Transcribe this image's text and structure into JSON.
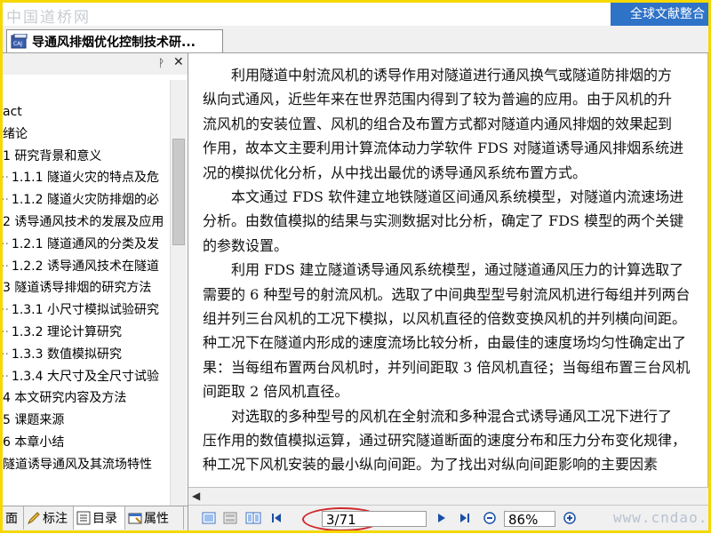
{
  "header": {
    "site_logo": "中国道桥网",
    "banner_text": "全球文献整合"
  },
  "tab": {
    "title": "导通风排烟优化控制技术研..."
  },
  "left_panel": {
    "toc": [
      {
        "label": "act",
        "level": 0
      },
      {
        "label": "绪论",
        "level": 0
      },
      {
        "label": "1 研究背景和意义",
        "level": 1
      },
      {
        "label": "1.1.1 隧道火灾的特点及危",
        "level": 3
      },
      {
        "label": "1.1.2 隧道火灾防排烟的必",
        "level": 3
      },
      {
        "label": "2 诱导通风技术的发展及应用",
        "level": 1
      },
      {
        "label": "1.2.1 隧道通风的分类及发",
        "level": 3
      },
      {
        "label": "1.2.2 诱导通风技术在隧道",
        "level": 3
      },
      {
        "label": "3 隧道诱导排烟的研究方法",
        "level": 1
      },
      {
        "label": "1.3.1 小尺寸模拟试验研究",
        "level": 3
      },
      {
        "label": "1.3.2 理论计算研究",
        "level": 3
      },
      {
        "label": "1.3.3 数值模拟研究",
        "level": 3
      },
      {
        "label": "1.3.4 大尺寸及全尺寸试验",
        "level": 3
      },
      {
        "label": "4 本文研究内容及方法",
        "level": 1
      },
      {
        "label": "5 课题来源",
        "level": 1
      },
      {
        "label": "6 本章小结",
        "level": 1
      },
      {
        "label": "隧道诱导通风及其流场特性",
        "level": 0
      }
    ],
    "tabs": {
      "pages_partial": "面",
      "annotations": "标注",
      "contents": "目录",
      "properties": "属性"
    }
  },
  "document": {
    "lines": [
      "　　利用隧道中射流风机的诱导作用对隧道进行通风换气或隧道防排烟的方",
      "纵向式通风，近些年来在世界范围内得到了较为普遍的应用。由于风机的升",
      "流风机的安装位置、风机的组合及布置方式都对隧道内通风排烟的效果起到",
      "作用，故本文主要利用计算流体动力学软件 FDS 对隧道诱导通风排烟系统进",
      "况的模拟优化分析，从中找出最优的诱导通风系统布置方式。",
      "　　本文通过 FDS 软件建立地铁隧道区间通风系统模型，对隧道内流速场进",
      "分析。由数值模拟的结果与实测数据对比分析，确定了 FDS 模型的两个关键",
      "的参数设置。",
      "　　利用 FDS 建立隧道诱导通风系统模型，通过隧道通风压力的计算选取了",
      "需要的 6 种型号的射流风机。选取了中间典型型号射流风机进行每组并列两台",
      "组并列三台风机的工况下模拟，以风机直径的倍数变换风机的并列横向间距。",
      "种工况下在隧道内形成的速度流场比较分析，由最佳的速度场均匀性确定出了",
      "果：当每组布置两台风机时，并列间距取 3 倍风机直径；当每组布置三台风机",
      "间距取 2 倍风机直径。",
      "　　对选取的多种型号的风机在全射流和多种混合式诱导通风工况下进行了",
      "压作用的数值模拟运算，通过研究隧道断面的速度分布和压力分布变化规律，",
      "种工况下风机安装的最小纵向间距。为了找出对纵向间距影响的主要因素"
    ]
  },
  "statusbar": {
    "page_value": "3/71",
    "zoom_value": "86%",
    "watermark": "www.cndao.com"
  },
  "colors": {
    "frame": "#f5d800",
    "banner": "#2f73c8",
    "highlight_ellipse": "#d0282a"
  }
}
